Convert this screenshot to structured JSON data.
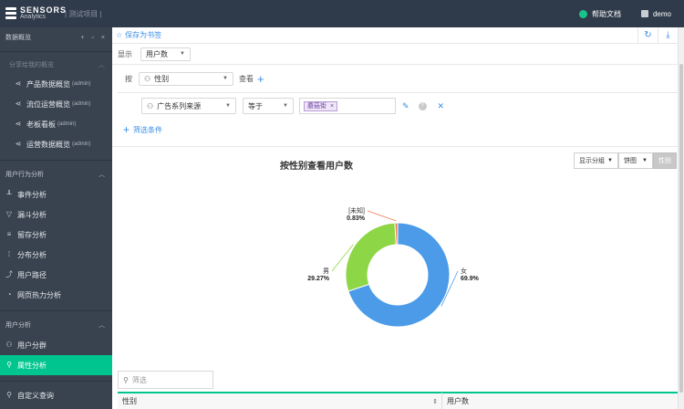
{
  "topbar": {
    "logo_line1": "SENSORS",
    "logo_line2": "Analytics",
    "project": "| 测试项目 |",
    "help": "帮助文档",
    "user": "demo"
  },
  "sidebar": {
    "overview_title": "数据概览",
    "overview_actions": [
      "+",
      "▫",
      "×"
    ],
    "shared_title": "分享给我的概览",
    "shared_items": [
      {
        "label": "产品数据概览",
        "owner": "(admin)"
      },
      {
        "label": "流位运营概览",
        "owner": "(admin)"
      },
      {
        "label": "老板看板",
        "owner": "(admin)"
      },
      {
        "label": "运营数据概览",
        "owner": "(admin)"
      }
    ],
    "behavior_title": "用户行为分析",
    "behavior_items": [
      {
        "label": "事件分析",
        "icon": "bar-chart-icon"
      },
      {
        "label": "漏斗分析",
        "icon": "funnel-icon"
      },
      {
        "label": "留存分析",
        "icon": "retention-icon"
      },
      {
        "label": "分布分析",
        "icon": "distribution-icon"
      },
      {
        "label": "用户路径",
        "icon": "path-icon"
      },
      {
        "label": "网页热力分析",
        "icon": "heatmap-icon"
      }
    ],
    "user_title": "用户分析",
    "user_items": [
      {
        "label": "用户分群",
        "icon": "group-icon"
      },
      {
        "label": "属性分析",
        "icon": "property-icon"
      }
    ],
    "custom_query": "自定义查询"
  },
  "toolbar": {
    "bookmark": "保存为书签"
  },
  "controls": {
    "display_label": "显示",
    "display_value": "用户数",
    "by_label": "按",
    "by_value": "性别",
    "view_label": "查看",
    "filter_field": "广告系列来源",
    "operator": "等于",
    "filter_tag": "蘑菇街",
    "add_filter": "筛选条件"
  },
  "chart_controls": {
    "group": "显示分组",
    "type": "饼图",
    "dimension": "性别"
  },
  "chart_data": {
    "type": "pie",
    "title": "按性别查看用户数",
    "slices": [
      {
        "label": "女",
        "percent": 69.9,
        "display": "69.9%",
        "color": "#4b9be8"
      },
      {
        "label": "男",
        "percent": 29.27,
        "display": "29.27%",
        "color": "#8dd646"
      },
      {
        "label": "[未知]",
        "percent": 0.83,
        "display": "0.83%",
        "color": "#f07a4b"
      }
    ]
  },
  "table": {
    "filter_placeholder": "筛选",
    "columns": [
      "性别",
      "用户数"
    ]
  }
}
